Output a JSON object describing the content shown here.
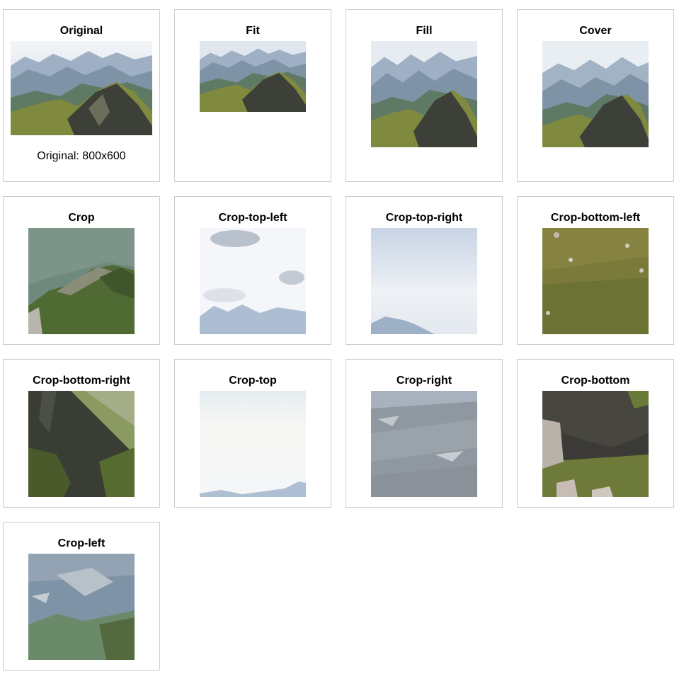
{
  "original": {
    "title": "Original",
    "caption": "Original: 800x600"
  },
  "fit": {
    "title": "Fit"
  },
  "fill": {
    "title": "Fill"
  },
  "cover": {
    "title": "Cover"
  },
  "crop": {
    "title": "Crop"
  },
  "crop_top_left": {
    "title": "Crop-top-left"
  },
  "crop_top_right": {
    "title": "Crop-top-right"
  },
  "crop_bottom_left": {
    "title": "Crop-bottom-left"
  },
  "crop_bottom_right": {
    "title": "Crop-bottom-right"
  },
  "crop_top": {
    "title": "Crop-top"
  },
  "crop_right": {
    "title": "Crop-right"
  },
  "crop_bottom": {
    "title": "Crop-bottom"
  },
  "crop_left": {
    "title": "Crop-left"
  }
}
